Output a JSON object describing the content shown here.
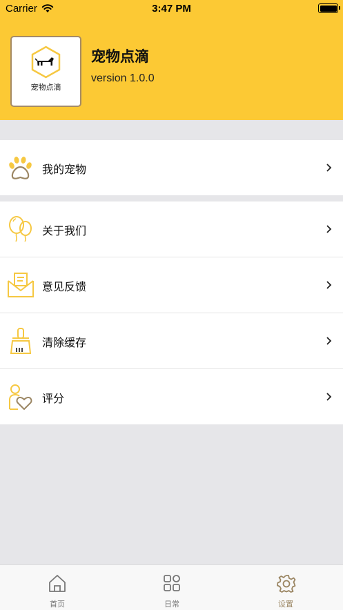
{
  "status_bar": {
    "carrier": "Carrier",
    "time": "3:47 PM"
  },
  "header": {
    "icon_caption": "宠物点滴",
    "title": "宠物点滴",
    "version": "version 1.0.0"
  },
  "menu_group_1": [
    {
      "label": "我的宠物",
      "icon": "paw-icon"
    }
  ],
  "menu_group_2": [
    {
      "label": "关于我们",
      "icon": "balloons-icon"
    },
    {
      "label": "意见反馈",
      "icon": "envelope-icon"
    },
    {
      "label": "清除缓存",
      "icon": "broom-icon"
    },
    {
      "label": "评分",
      "icon": "person-heart-icon"
    }
  ],
  "tabbar": {
    "tabs": [
      {
        "label": "首页",
        "icon": "home-icon"
      },
      {
        "label": "日常",
        "icon": "grid-icon"
      },
      {
        "label": "设置",
        "icon": "settings-icon",
        "active": true
      }
    ]
  },
  "colors": {
    "header_yellow": "#fcc934",
    "icon_yellow": "#f6c842",
    "icon_brown": "#9b8663",
    "background": "#e6e6e9"
  }
}
